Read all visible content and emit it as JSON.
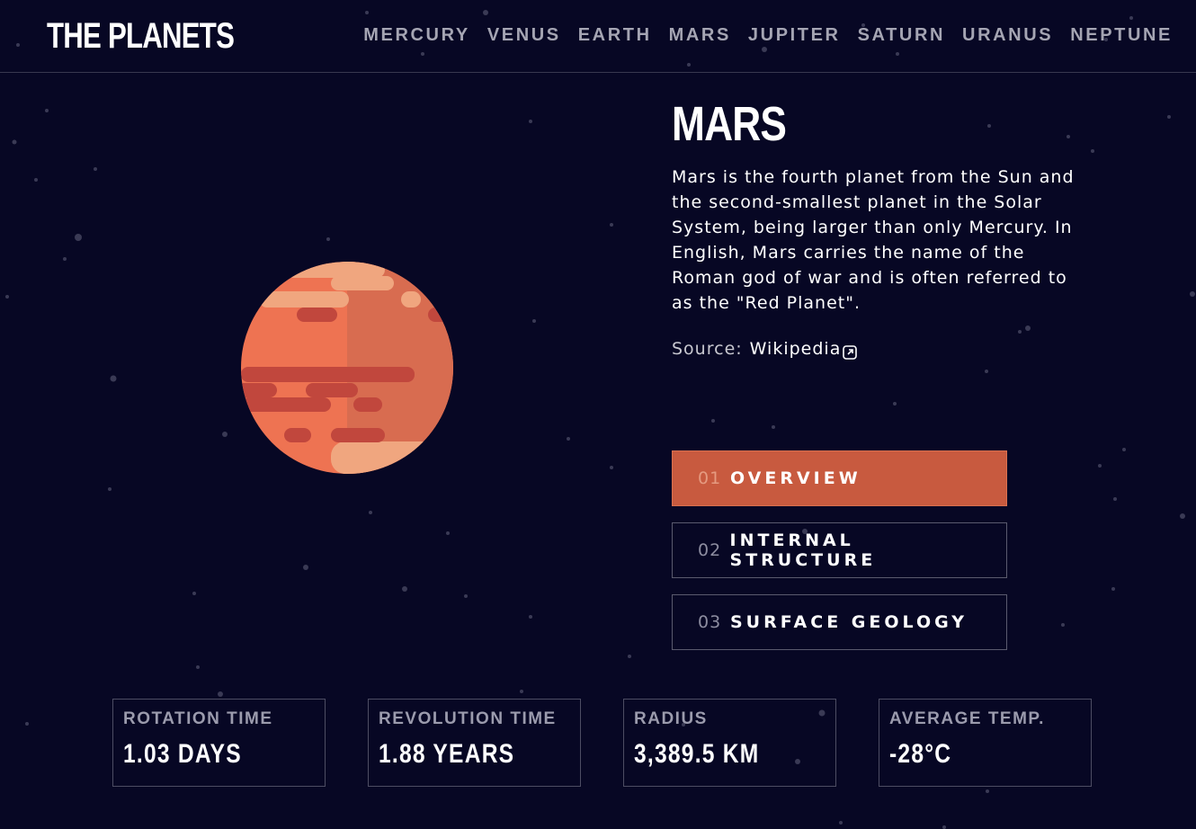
{
  "logo": "THE PLANETS",
  "nav": [
    "MERCURY",
    "VENUS",
    "EARTH",
    "MARS",
    "JUPITER",
    "SATURN",
    "URANUS",
    "NEPTUNE"
  ],
  "planet": {
    "name": "MARS",
    "description": "Mars is the fourth planet from the Sun and the second-smallest planet in the Solar System, being larger than only Mercury. In English, Mars carries the name of the Roman god of war and is often referred to as the \"Red Planet\".",
    "source_label": "Source:",
    "source_link": "Wikipedia",
    "source_icon": "external-link-icon"
  },
  "tabs": [
    {
      "num": "01",
      "label": "OVERVIEW",
      "active": true
    },
    {
      "num": "02",
      "label": "INTERNAL STRUCTURE",
      "active": false
    },
    {
      "num": "03",
      "label": "SURFACE GEOLOGY",
      "active": false
    }
  ],
  "stats": [
    {
      "label": "ROTATION TIME",
      "value": "1.03 DAYS"
    },
    {
      "label": "REVOLUTION TIME",
      "value": "1.88 YEARS"
    },
    {
      "label": "RADIUS",
      "value": "3,389.5 KM"
    },
    {
      "label": "AVERAGE TEMP.",
      "value": "-28°C"
    }
  ],
  "colors": {
    "background": "#070724",
    "accent_active_tab": "#c85a3f",
    "planet_main": "#ee7352",
    "planet_shadow": "#d86c50"
  }
}
